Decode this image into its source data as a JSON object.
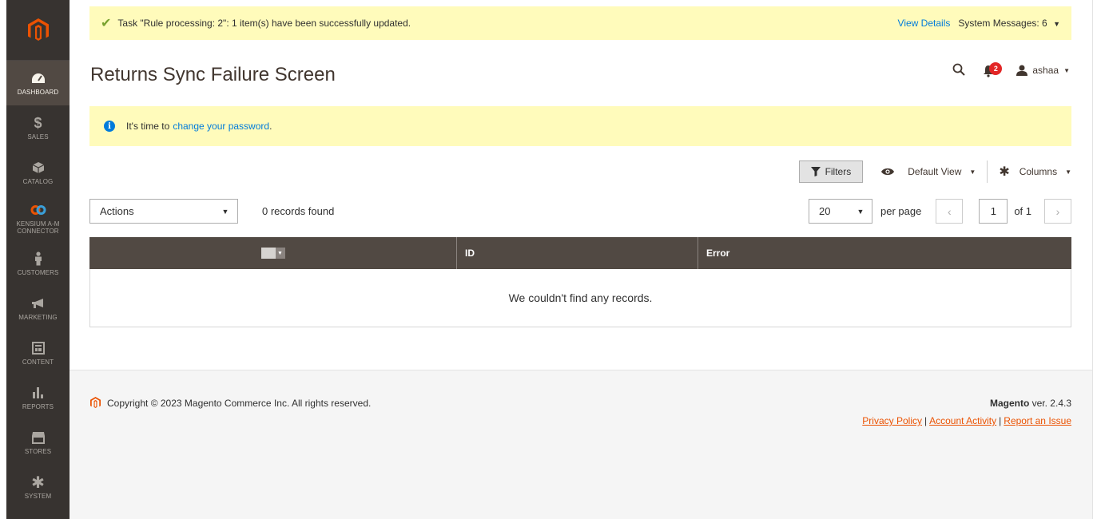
{
  "sidebar": {
    "items": [
      {
        "label": "DASHBOARD",
        "icon": "dashboard-icon"
      },
      {
        "label": "SALES",
        "icon": "dollar-icon"
      },
      {
        "label": "CATALOG",
        "icon": "cube-icon"
      },
      {
        "label": "KENSIUM A-M CONNECTOR",
        "icon": "link-icon"
      },
      {
        "label": "CUSTOMERS",
        "icon": "person-icon"
      },
      {
        "label": "MARKETING",
        "icon": "megaphone-icon"
      },
      {
        "label": "CONTENT",
        "icon": "layout-icon"
      },
      {
        "label": "REPORTS",
        "icon": "bar-chart-icon"
      },
      {
        "label": "STORES",
        "icon": "store-icon"
      },
      {
        "label": "SYSTEM",
        "icon": "gear-icon"
      }
    ]
  },
  "system_message": {
    "text": "Task \"Rule processing: 2\": 1 item(s) have been successfully updated.",
    "view_details": "View Details",
    "system_messages": "System Messages: 6"
  },
  "header": {
    "title": "Returns Sync Failure Screen",
    "notification_count": "2",
    "user_name": "ashaa"
  },
  "notice": {
    "prefix": "It's time to ",
    "link": "change your password",
    "suffix": "."
  },
  "toolbar": {
    "filters_label": "Filters",
    "view_label": "Default View",
    "columns_label": "Columns"
  },
  "grid_controls": {
    "actions_label": "Actions",
    "records_found": "0 records found",
    "per_page_value": "20",
    "per_page_label": "per page",
    "page_value": "1",
    "page_of": "of 1"
  },
  "grid": {
    "columns": [
      "ID",
      "Error"
    ],
    "empty_message": "We couldn't find any records."
  },
  "footer": {
    "copyright": "Copyright © 2023 Magento Commerce Inc. All rights reserved.",
    "brand": "Magento",
    "version": " ver. 2.4.3",
    "links": [
      "Privacy Policy",
      "Account Activity",
      "Report an Issue"
    ]
  },
  "colors": {
    "sidebar_bg": "#373330",
    "accent_orange": "#eb5202",
    "message_bg": "#fffbbb",
    "grid_header_bg": "#514943",
    "link_blue": "#007bdb"
  }
}
